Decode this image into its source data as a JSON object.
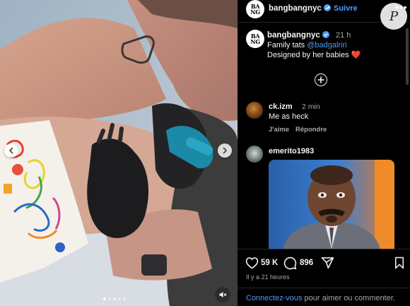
{
  "post": {
    "username": "bangbangnyc",
    "follow_label": "Suivre",
    "separator": "•",
    "more_label": "•••",
    "avatar_text": "B A\nN G"
  },
  "caption": {
    "username": "bangbangnyc",
    "time": "21 h",
    "text_prefix": "Family tats ",
    "mention": "@badgalriri",
    "line2_text": "Designed by her babies ",
    "heart": "❤️"
  },
  "comments": [
    {
      "user": "ck.izm",
      "time": "2 min",
      "text": "Me as heck",
      "like_label": "J'aime",
      "reply_label": "Répondre"
    },
    {
      "user": "emerito1983",
      "media": "gif"
    }
  ],
  "stats": {
    "likes": "59 K",
    "comments": "896",
    "posted": "Il y a 21 heures"
  },
  "footer": {
    "login_link": "Connectez-vous",
    "login_rest": " pour aimer ou commenter."
  },
  "carousel": {
    "slide_count": 5,
    "active_slide": 1
  },
  "watermark": "P",
  "colors": {
    "link": "#4f9cf9",
    "muted": "#a8a8a8",
    "heart": "#ed4956",
    "background": "#000000"
  },
  "icons": [
    "chevron-left-icon",
    "chevron-right-icon",
    "mute-icon",
    "verified-icon",
    "heart-icon",
    "comment-icon",
    "share-icon",
    "bookmark-icon",
    "plus-circle-icon"
  ]
}
